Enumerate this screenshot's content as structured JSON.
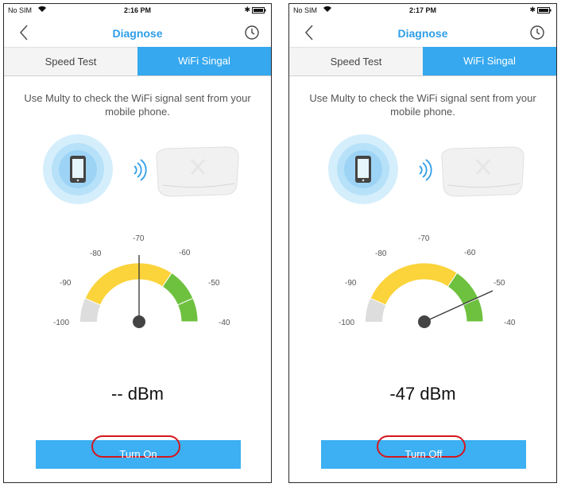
{
  "screens": [
    {
      "status": {
        "carrier": "No SIM",
        "time": "2:16 PM"
      },
      "nav": {
        "title": "Diagnose"
      },
      "tabs": [
        {
          "label": "Speed Test"
        },
        {
          "label": "WiFi Singal"
        }
      ],
      "description": "Use Multy to check the WiFi signal sent from your mobile phone.",
      "gauge": {
        "min": -100,
        "max": -40,
        "value": -70,
        "labels": [
          "-100",
          "-90",
          "-80",
          "-70",
          "-60",
          "-50",
          "-40"
        ],
        "needle_angle_deg": 90
      },
      "reading": "-- dBm",
      "button_label": "Turn On"
    },
    {
      "status": {
        "carrier": "No SIM",
        "time": "2:17 PM"
      },
      "nav": {
        "title": "Diagnose"
      },
      "tabs": [
        {
          "label": "Speed Test"
        },
        {
          "label": "WiFi Singal"
        }
      ],
      "description": "Use Multy to check the WiFi signal sent from your mobile phone.",
      "gauge": {
        "min": -100,
        "max": -40,
        "value": -47,
        "labels": [
          "-100",
          "-90",
          "-80",
          "-70",
          "-60",
          "-50",
          "-40"
        ],
        "needle_angle_deg": 25
      },
      "reading": "-47 dBm",
      "button_label": "Turn Off"
    }
  ],
  "colors": {
    "accent": "#35a8ef",
    "title": "#2e9ee8",
    "gauge_gray": "#dddddd",
    "gauge_yellow": "#fbd33a",
    "gauge_green": "#6ec13f",
    "highlight": "#d4171d"
  },
  "icons": {
    "back": "chevron-left-icon",
    "history": "clock-icon",
    "wifi_status": "wifi-icon",
    "bluetooth": "bluetooth-icon",
    "battery": "battery-icon",
    "phone": "phone-icon",
    "signal": "signal-waves-icon",
    "router": "router-icon"
  }
}
